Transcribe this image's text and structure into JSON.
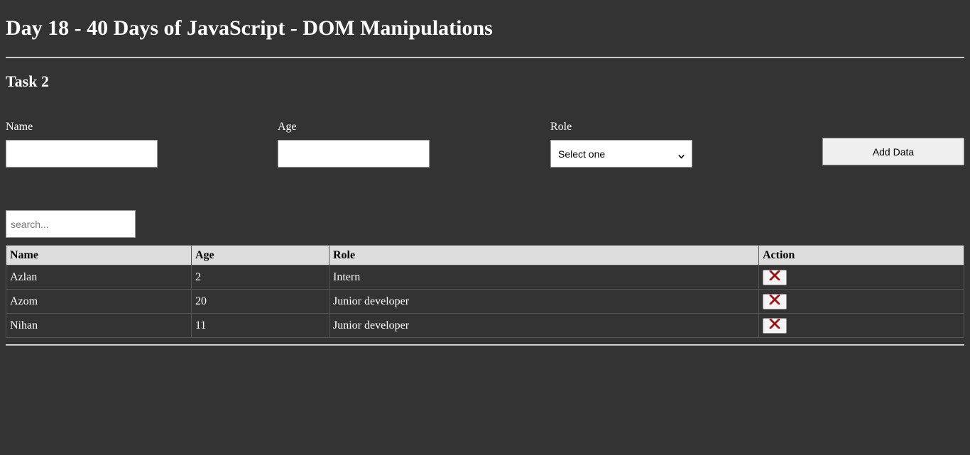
{
  "page": {
    "title": "Day 18 - 40 Days of JavaScript - DOM Manipulations",
    "task_heading": "Task 2"
  },
  "form": {
    "name_label": "Name",
    "name_value": "",
    "age_label": "Age",
    "age_value": "",
    "role_label": "Role",
    "role_selected": "Select one",
    "add_button_label": "Add Data"
  },
  "search": {
    "placeholder": "search...",
    "value": ""
  },
  "table": {
    "headers": [
      "Name",
      "Age",
      "Role",
      "Action"
    ],
    "rows": [
      {
        "name": "Azlan",
        "age": "2",
        "role": "Intern",
        "action_icon": "close-x-icon"
      },
      {
        "name": "Azom",
        "age": "20",
        "role": "Junior developer",
        "action_icon": "close-x-icon"
      },
      {
        "name": "Nihan",
        "age": "11",
        "role": "Junior developer",
        "action_icon": "close-x-icon"
      }
    ]
  },
  "colors": {
    "background": "#333333",
    "text": "#ffffff",
    "table_header_bg": "#dddddd",
    "delete_icon": "#b22222"
  }
}
